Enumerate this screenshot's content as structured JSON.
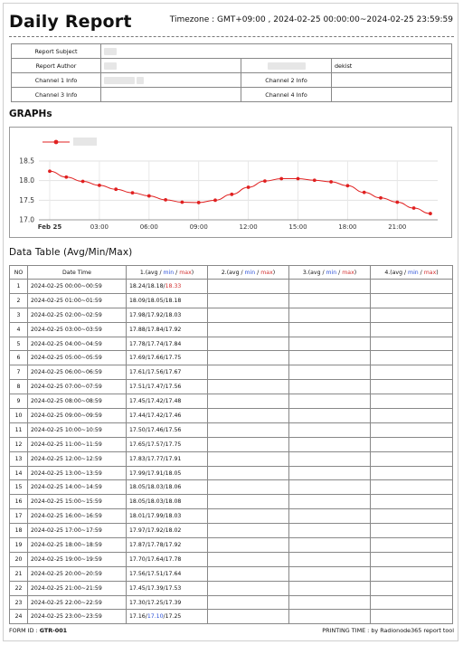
{
  "header": {
    "title": "Daily Report",
    "timezone": "Timezone : GMT+09:00 , 2024-02-25 00:00:00~2024-02-25 23:59:59"
  },
  "info": {
    "report_subject_label": "Report Subject",
    "report_author_label": "Report Author",
    "author_extra": "dekist",
    "channel1_label": "Channel 1 Info",
    "channel2_label": "Channel 2 Info",
    "channel3_label": "Channel 3 Info",
    "channel4_label": "Channel 4 Info"
  },
  "sections": {
    "graphs": "GRAPHs",
    "data_table": "Data Table (Avg/Min/Max)"
  },
  "chart_data": {
    "type": "line",
    "x_tick_labels": [
      "Feb 25",
      "03:00",
      "06:00",
      "09:00",
      "12:00",
      "15:00",
      "18:00",
      "21:00"
    ],
    "y_tick_labels": [
      "18.5",
      "18.0",
      "17.5",
      "17.0"
    ],
    "ylim": [
      17.0,
      18.5
    ],
    "grid": true,
    "series": [
      {
        "color": "#e02020",
        "values": [
          18.24,
          18.09,
          17.98,
          17.88,
          17.78,
          17.69,
          17.61,
          17.51,
          17.45,
          17.44,
          17.5,
          17.65,
          17.83,
          17.99,
          18.05,
          18.05,
          18.01,
          17.97,
          17.87,
          17.7,
          17.56,
          17.45,
          17.3,
          17.16
        ]
      }
    ]
  },
  "table": {
    "headers": {
      "no": "NO",
      "datetime": "Date Time",
      "ch1": "1.(avg / ",
      "ch2": "2.(avg / ",
      "ch3": "3.(avg / ",
      "ch4": "4.(avg / ",
      "min": "min",
      "slash": " / ",
      "max": "max",
      "close": ")"
    },
    "rows": [
      {
        "no": "1",
        "time": "2024-02-25 00:00~00:59",
        "avg": "18.24",
        "min": "18.18",
        "max": "18.33"
      },
      {
        "no": "2",
        "time": "2024-02-25 01:00~01:59",
        "avg": "18.09",
        "min": "18.05",
        "max": "18.18"
      },
      {
        "no": "3",
        "time": "2024-02-25 02:00~02:59",
        "avg": "17.98",
        "min": "17.92",
        "max": "18.03"
      },
      {
        "no": "4",
        "time": "2024-02-25 03:00~03:59",
        "avg": "17.88",
        "min": "17.84",
        "max": "17.92"
      },
      {
        "no": "5",
        "time": "2024-02-25 04:00~04:59",
        "avg": "17.78",
        "min": "17.74",
        "max": "17.84"
      },
      {
        "no": "6",
        "time": "2024-02-25 05:00~05:59",
        "avg": "17.69",
        "min": "17.66",
        "max": "17.75"
      },
      {
        "no": "7",
        "time": "2024-02-25 06:00~06:59",
        "avg": "17.61",
        "min": "17.56",
        "max": "17.67"
      },
      {
        "no": "8",
        "time": "2024-02-25 07:00~07:59",
        "avg": "17.51",
        "min": "17.47",
        "max": "17.56"
      },
      {
        "no": "9",
        "time": "2024-02-25 08:00~08:59",
        "avg": "17.45",
        "min": "17.42",
        "max": "17.48"
      },
      {
        "no": "10",
        "time": "2024-02-25 09:00~09:59",
        "avg": "17.44",
        "min": "17.42",
        "max": "17.46"
      },
      {
        "no": "11",
        "time": "2024-02-25 10:00~10:59",
        "avg": "17.50",
        "min": "17.46",
        "max": "17.56"
      },
      {
        "no": "12",
        "time": "2024-02-25 11:00~11:59",
        "avg": "17.65",
        "min": "17.57",
        "max": "17.75"
      },
      {
        "no": "13",
        "time": "2024-02-25 12:00~12:59",
        "avg": "17.83",
        "min": "17.77",
        "max": "17.91"
      },
      {
        "no": "14",
        "time": "2024-02-25 13:00~13:59",
        "avg": "17.99",
        "min": "17.91",
        "max": "18.05"
      },
      {
        "no": "15",
        "time": "2024-02-25 14:00~14:59",
        "avg": "18.05",
        "min": "18.03",
        "max": "18.06"
      },
      {
        "no": "16",
        "time": "2024-02-25 15:00~15:59",
        "avg": "18.05",
        "min": "18.03",
        "max": "18.08"
      },
      {
        "no": "17",
        "time": "2024-02-25 16:00~16:59",
        "avg": "18.01",
        "min": "17.99",
        "max": "18.03"
      },
      {
        "no": "18",
        "time": "2024-02-25 17:00~17:59",
        "avg": "17.97",
        "min": "17.92",
        "max": "18.02"
      },
      {
        "no": "19",
        "time": "2024-02-25 18:00~18:59",
        "avg": "17.87",
        "min": "17.78",
        "max": "17.92"
      },
      {
        "no": "20",
        "time": "2024-02-25 19:00~19:59",
        "avg": "17.70",
        "min": "17.64",
        "max": "17.78"
      },
      {
        "no": "21",
        "time": "2024-02-25 20:00~20:59",
        "avg": "17.56",
        "min": "17.51",
        "max": "17.64"
      },
      {
        "no": "22",
        "time": "2024-02-25 21:00~21:59",
        "avg": "17.45",
        "min": "17.39",
        "max": "17.53"
      },
      {
        "no": "23",
        "time": "2024-02-25 22:00~22:59",
        "avg": "17.30",
        "min": "17.25",
        "max": "17.39"
      },
      {
        "no": "24",
        "time": "2024-02-25 23:00~23:59",
        "avg": "17.16",
        "min": "17.10",
        "max": "17.25"
      }
    ]
  },
  "footer": {
    "form_id_label": "FORM ID : ",
    "form_id": "GTR-001",
    "printing": "PRINTING TIME : by Radionode365 report tool"
  }
}
